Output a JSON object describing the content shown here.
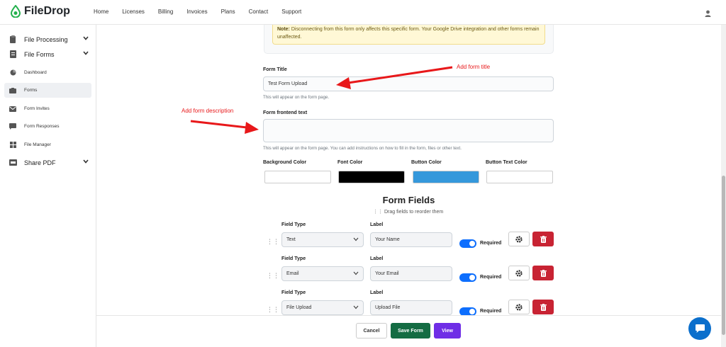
{
  "brand": {
    "name": "FileDrop"
  },
  "nav": {
    "items": [
      "Home",
      "Licenses",
      "Billing",
      "Invoices",
      "Plans",
      "Contact",
      "Support"
    ]
  },
  "sidebar": {
    "file_processing": "File Processing",
    "file_forms": "File Forms",
    "dashboard": "Dashboard",
    "forms": "Forms",
    "form_invites": "Form Invites",
    "form_responses": "Form Responses",
    "file_manager": "File Manager",
    "share_pdf": "Share PDF"
  },
  "note": {
    "label": "Note:",
    "text": " Disconnecting from this form only affects this specific form. Your Google Drive integration and other forms remain unaffected."
  },
  "form": {
    "title_label": "Form Title",
    "title_value": "Test Form Upload",
    "title_help": "This will appear on the form page.",
    "frontend_label": "Form frontend text",
    "frontend_value": "",
    "frontend_help": "This will appear on the form page. You can add instructions on how to fill in the form, files or other text."
  },
  "annotations": {
    "title": "Add form title",
    "description": "Add form description"
  },
  "colors": {
    "background_label": "Background Color",
    "background_value": "#ffffff",
    "font_label": "Font Color",
    "font_value": "#000000",
    "button_label": "Button Color",
    "button_value": "#3598db",
    "button_text_label": "Button Text Color",
    "button_text_value": "#ffffff"
  },
  "form_fields": {
    "heading": "Form Fields",
    "drag_help": "Drag fields to reorder them",
    "field_type_label": "Field Type",
    "label_label": "Label",
    "required_label": "Required",
    "rows": [
      {
        "type": "Text",
        "label": "Your Name",
        "required": true
      },
      {
        "type": "Email",
        "label": "Your Email",
        "required": true
      },
      {
        "type": "File Upload",
        "label": "Upload File",
        "required": true
      }
    ]
  },
  "footer": {
    "cancel": "Cancel",
    "save": "Save Form",
    "view": "View"
  },
  "theme": {
    "accent": "#0d6efd",
    "save_green": "#146c43",
    "view_purple": "#6f2ee6",
    "danger": "#c82333",
    "annotation_red": "#e8181a",
    "brand_green": "#22b14c"
  }
}
